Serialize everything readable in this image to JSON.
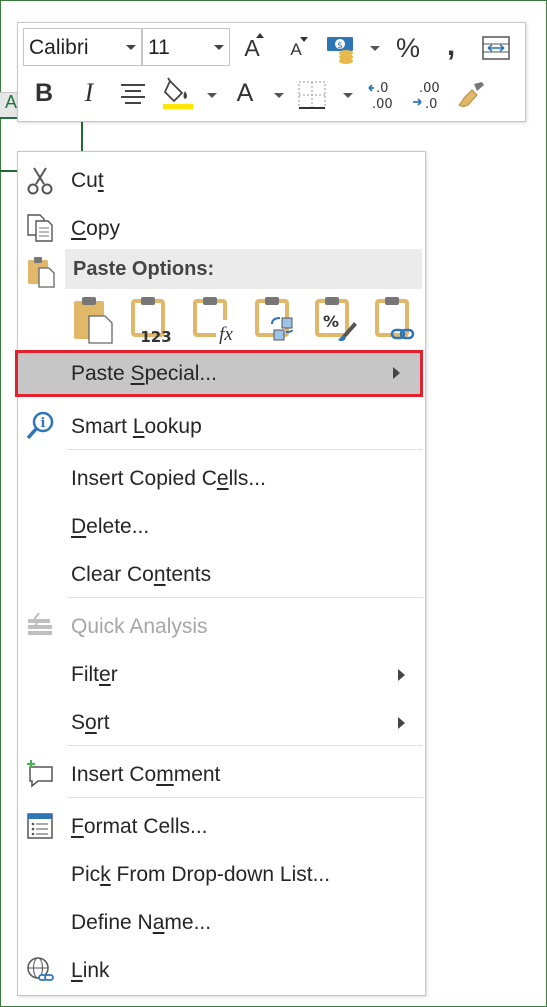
{
  "sheet": {
    "column_letter": "A"
  },
  "mini_toolbar": {
    "font_name": "Calibri",
    "font_size": "11",
    "increase_font_label": "A",
    "decrease_font_label": "A",
    "percent_label": "%",
    "comma_label": ",",
    "bold_label": "B",
    "italic_label": "I",
    "font_color_label": "A",
    "inc_decimal_top": ".0",
    "inc_decimal_bottom": ".00",
    "dec_decimal_top": ".00",
    "dec_decimal_bottom": ".0"
  },
  "context_menu": {
    "cut": {
      "pre": "Cu",
      "key": "t",
      "post": ""
    },
    "copy": {
      "pre": "",
      "key": "C",
      "post": "opy"
    },
    "paste_options": "Paste Options:",
    "paste_values_badge": "123",
    "paste_formula_badge": "fx",
    "paste_pct_badge": "%",
    "paste_special": {
      "pre": "Paste ",
      "key": "S",
      "post": "pecial..."
    },
    "smart_lookup": {
      "pre": "Smart ",
      "key": "L",
      "post": "ookup"
    },
    "insert_copied_cells": {
      "pre": "Insert Copied C",
      "key": "e",
      "post": "lls..."
    },
    "delete": {
      "pre": "",
      "key": "D",
      "post": "elete..."
    },
    "clear_contents": {
      "pre": "Clear Co",
      "key": "n",
      "post": "tents"
    },
    "quick_analysis": "Quick Analysis",
    "filter": {
      "pre": "Filt",
      "key": "e",
      "post": "r"
    },
    "sort": {
      "pre": "S",
      "key": "o",
      "post": "rt"
    },
    "insert_comment": {
      "pre": "Insert Co",
      "key": "m",
      "post": "ment"
    },
    "format_cells": {
      "pre": "",
      "key": "F",
      "post": "ormat Cells..."
    },
    "pick_from_list": {
      "pre": "Pic",
      "key": "k",
      "post": " From Drop-down List..."
    },
    "define_name": {
      "pre": "Define N",
      "key": "a",
      "post": "me..."
    },
    "link": {
      "pre": "",
      "key": "L",
      "post": "ink"
    }
  },
  "colors": {
    "highlight_border": "#e3202b",
    "highlight_fill": "#c6c6c6",
    "clipboard": "#e1b76a",
    "excel_green": "#217346"
  }
}
